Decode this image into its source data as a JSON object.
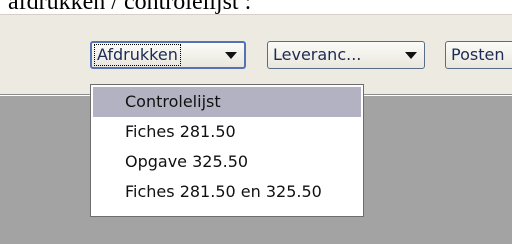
{
  "caption": "afdrukken / controlelijst :",
  "toolbar": {
    "print_combo": {
      "label": "Afdrukken"
    },
    "delivery_combo": {
      "label": "Leveranc..."
    },
    "posts_combo": {
      "label": "Posten"
    }
  },
  "print_menu": {
    "items": [
      {
        "label": "Controlelijst",
        "selected": true
      },
      {
        "label": "Fiches 281.50",
        "selected": false
      },
      {
        "label": "Opgave 325.50",
        "selected": false
      },
      {
        "label": "Fiches 281.50 en 325.50",
        "selected": false
      }
    ]
  },
  "colors": {
    "toolbar_bg": "#eceae1",
    "content_bg": "#a3a3a3",
    "selected_item_bg": "#b3b2c2",
    "combo_text": "#1c2a55"
  }
}
